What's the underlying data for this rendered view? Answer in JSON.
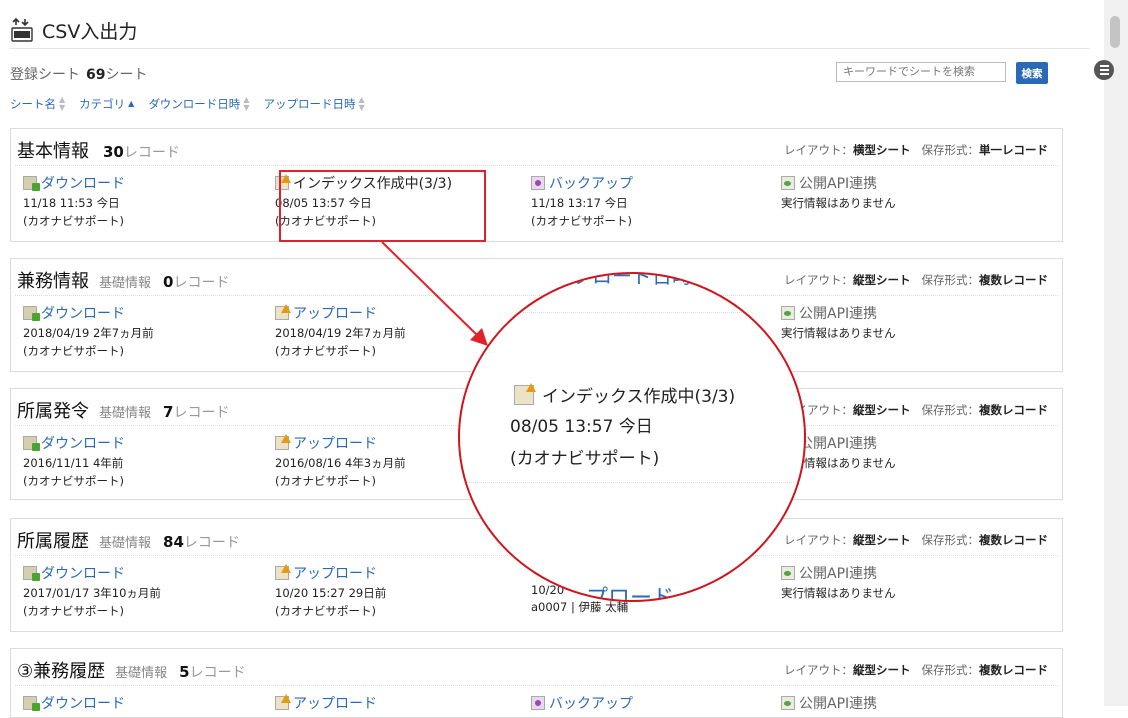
{
  "page": {
    "title": "CSV入出力",
    "icon_label": "CSV",
    "registered_label": "登録シート",
    "registered_count": "69",
    "registered_unit": "シート"
  },
  "search": {
    "placeholder": "キーワードでシートを検索",
    "button": "検索"
  },
  "sort": [
    {
      "label": "シート名",
      "active": false
    },
    {
      "label": "カテゴリ",
      "active": true
    },
    {
      "label": "ダウンロード日時",
      "active": false
    },
    {
      "label": "アップロード日時",
      "active": false
    }
  ],
  "meta_labels": {
    "layout": "レイアウト：",
    "format": "保存形式："
  },
  "sheets": [
    {
      "name": "基本情報",
      "category": "",
      "count": "30",
      "unit": "レコード",
      "layout": "横型シート",
      "format": "単一レコード",
      "cols": [
        {
          "icon": "download-icon",
          "label": "ダウンロード",
          "line1": "11/18 11:53 今日",
          "line2": "(カオナビサポート)"
        },
        {
          "icon": "upload-icon",
          "label": "インデックス作成中(3/3)",
          "line1": "08/05 13:57 今日",
          "line2": "(カオナビサポート)"
        },
        {
          "icon": "backup-icon",
          "label": "バックアップ",
          "line1": "11/18 13:17 今日",
          "line2": "(カオナビサポート)"
        },
        {
          "icon": "api-icon",
          "label": "公開API連携",
          "line1": "実行情報はありません",
          "line2": ""
        }
      ]
    },
    {
      "name": "兼務情報",
      "category": "基礎情報",
      "count": "0",
      "unit": "レコード",
      "layout": "縦型シート",
      "format": "複数レコード",
      "cols": [
        {
          "icon": "download-icon",
          "label": "ダウンロード",
          "line1": "2018/04/19 2年7ヵ月前",
          "line2": "(カオナビサポート)"
        },
        {
          "icon": "upload-icon",
          "label": "アップロード",
          "line1": "2018/04/19 2年7ヵ月前",
          "line2": "(カオナビサポート)"
        },
        {
          "icon": "api-icon",
          "label": "公開API連携",
          "line1": "実行情報はありません",
          "line2": ""
        }
      ]
    },
    {
      "name": "所属発令",
      "category": "基礎情報",
      "count": "7",
      "unit": "レコード",
      "layout": "縦型シート",
      "format": "複数レコード",
      "cols": [
        {
          "icon": "download-icon",
          "label": "ダウンロード",
          "line1": "2016/11/11 4年前",
          "line2": "(カオナビサポート)"
        },
        {
          "icon": "upload-icon",
          "label": "アップロード",
          "line1": "2016/08/16 4年3ヵ月前",
          "line2": "(カオナビサポート)"
        },
        {
          "icon": "api-icon",
          "label": "公開API連携",
          "line1": "実行情報はありません",
          "line2": ""
        }
      ]
    },
    {
      "name": "所属履歴",
      "category": "基礎情報",
      "count": "84",
      "unit": "レコード",
      "layout": "縦型シート",
      "format": "複数レコード",
      "cols": [
        {
          "icon": "download-icon",
          "label": "ダウンロード",
          "line1": "2017/01/17 3年10ヵ月前",
          "line2": "(カオナビサポート)"
        },
        {
          "icon": "upload-icon",
          "label": "アップロード",
          "line1": "10/20 15:27 29日前",
          "line2": "(カオナビサポート)"
        },
        {
          "icon": "backup-icon",
          "label": "",
          "line1": "10/20",
          "line2": "a0007 | 伊藤 太輔"
        },
        {
          "icon": "api-icon",
          "label": "公開API連携",
          "line1": "実行情報はありません",
          "line2": ""
        }
      ]
    },
    {
      "name": "③兼務履歴",
      "category": "基礎情報",
      "count": "5",
      "unit": "レコード",
      "layout": "縦型シート",
      "format": "複数レコード",
      "cols": [
        {
          "icon": "download-icon",
          "label": "ダウンロード",
          "line1": "",
          "line2": ""
        },
        {
          "icon": "upload-icon",
          "label": "アップロード",
          "line1": "",
          "line2": ""
        },
        {
          "icon": "backup-icon",
          "label": "バックアップ",
          "line1": "",
          "line2": ""
        },
        {
          "icon": "api-icon",
          "label": "公開API連携",
          "line1": "",
          "line2": ""
        }
      ]
    }
  ],
  "zoom": {
    "top_text": "プロード日時",
    "bottom_text": "アップロード",
    "label": "インデックス作成中(3/3)",
    "line1": "08/05 13:57 今日",
    "line2": "(カオナビサポート)"
  },
  "colors": {
    "link": "#2a69b6",
    "highlight": "#e2222b",
    "search_button": "#2a69b6"
  }
}
